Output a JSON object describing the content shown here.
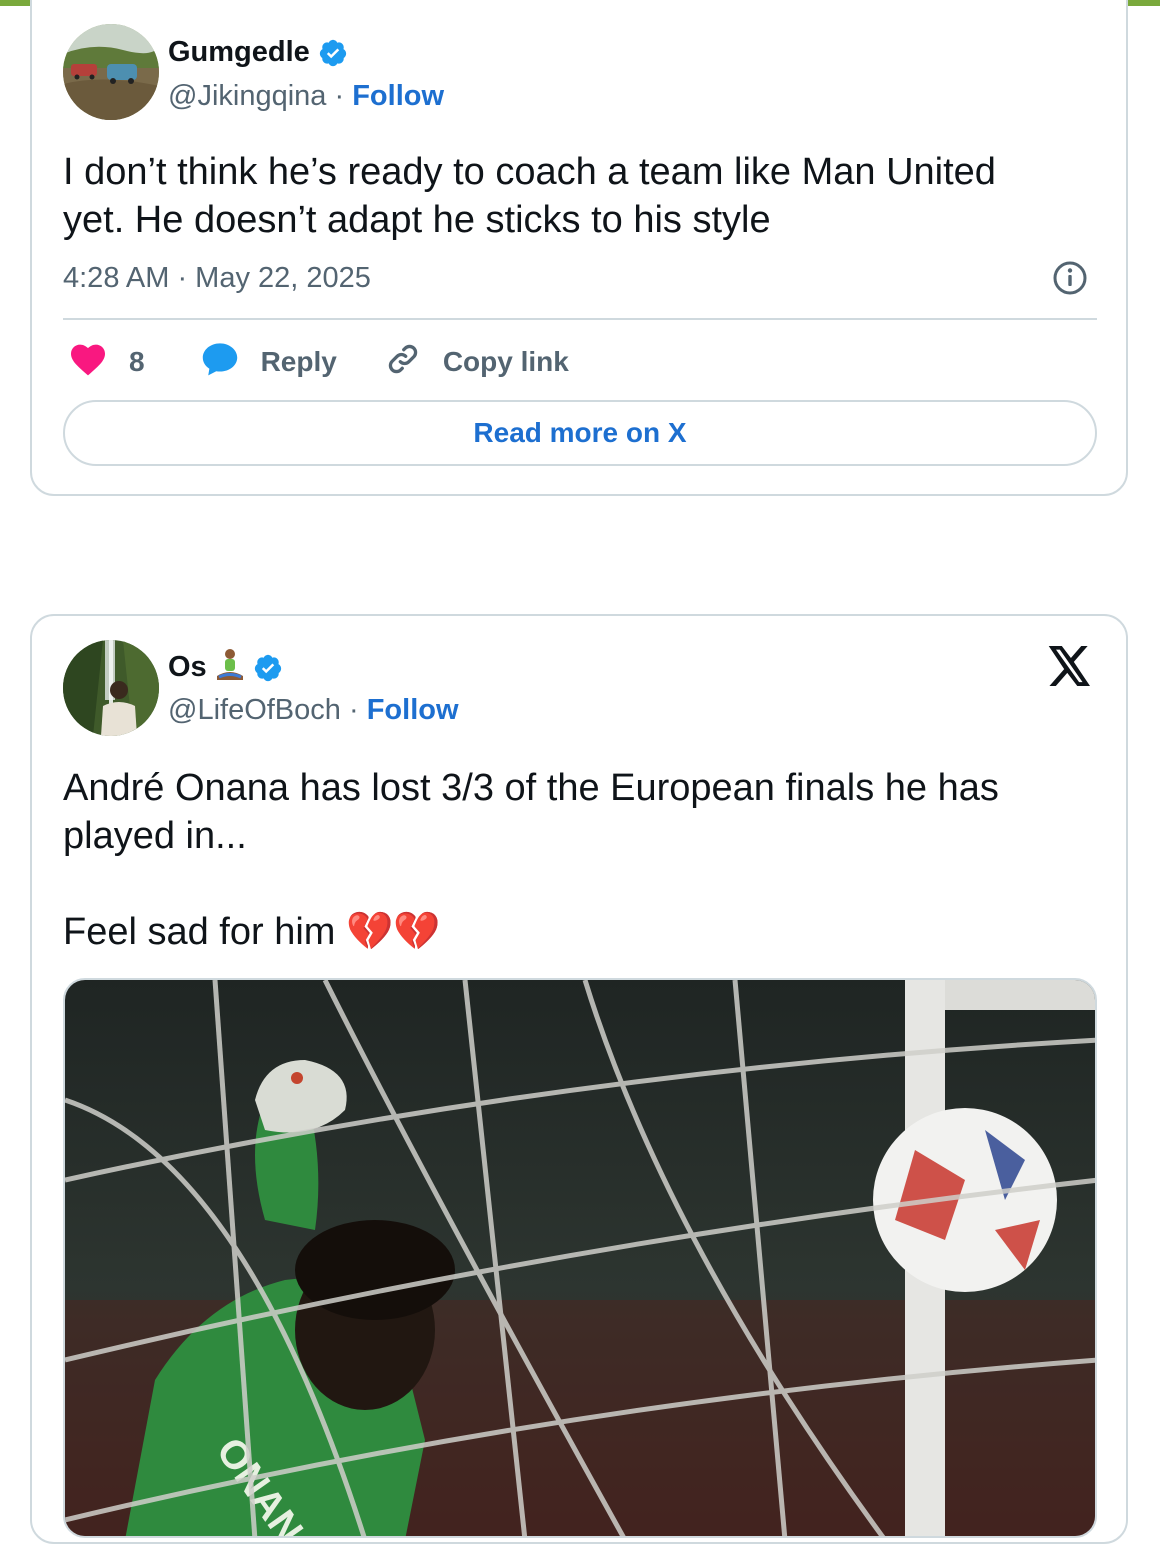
{
  "colors": {
    "accent_bar": "#7aa93c",
    "link_blue": "#1d6fd0",
    "verified_blue": "#1d9bf0",
    "like_pink": "#f91880",
    "text_primary": "#0f1419",
    "text_secondary": "#536471",
    "border": "#cfd9de"
  },
  "tweets": [
    {
      "author": {
        "name": "Gumgedle",
        "verified": true,
        "handle": "@Jikingqina",
        "separator": "·",
        "follow_label": "Follow"
      },
      "text": "I don’t think he’s ready to coach a team like Man United\nyet. He doesn’t adapt he sticks to his style",
      "timestamp": "4:28 AM · May 22, 2025",
      "actions": {
        "like_count": "8",
        "reply_label": "Reply",
        "copy_link_label": "Copy link"
      },
      "read_more_label": "Read more on X",
      "icons": [
        "avatar-photo",
        "verified-badge-icon",
        "info-icon",
        "heart-icon",
        "reply-bubble-icon",
        "link-icon"
      ]
    },
    {
      "author": {
        "name": "Os",
        "name_emoji": "🧘🏾‍♂️",
        "verified": true,
        "handle": "@LifeOfBoch",
        "separator": "·",
        "follow_label": "Follow"
      },
      "text_line1": "André Onana has lost 3/3 of the European finals he has\nplayed in...",
      "text_line2": "Feel sad for him 💔💔",
      "media_alt": "Goalkeeper in green kit reaching for a ball behind the net",
      "media_jersey_text": "ONANA",
      "icons": [
        "avatar-photo",
        "verified-badge-icon",
        "x-logo-icon",
        "broken-heart-emoji"
      ]
    }
  ]
}
